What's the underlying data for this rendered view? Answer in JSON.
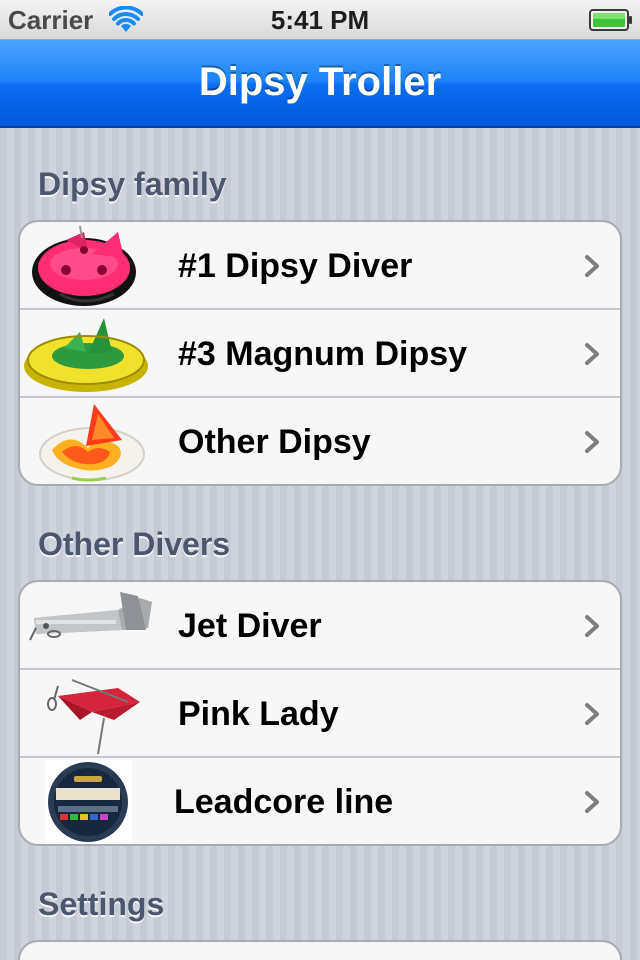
{
  "status_bar": {
    "carrier": "Carrier",
    "time": "5:41 PM",
    "wifi_icon": "wifi-icon",
    "battery_icon": "battery-full-icon"
  },
  "nav_bar": {
    "title": "Dipsy Troller"
  },
  "sections": [
    {
      "header": "Dipsy family",
      "items": [
        {
          "label": "#1 Dipsy Diver",
          "thumbnail": "pink-dipsy-diver-image"
        },
        {
          "label": "#3 Magnum Dipsy",
          "thumbnail": "yellow-magnum-dipsy-image"
        },
        {
          "label": "Other Dipsy",
          "thumbnail": "flame-dipsy-image"
        }
      ]
    },
    {
      "header": "Other Divers",
      "items": [
        {
          "label": "Jet Diver",
          "thumbnail": "jet-diver-image"
        },
        {
          "label": "Pink Lady",
          "thumbnail": "pink-lady-image"
        },
        {
          "label": "Leadcore line",
          "thumbnail": "leadcore-spool-image"
        }
      ]
    },
    {
      "header": "Settings",
      "items": []
    }
  ],
  "colors": {
    "nav_bar_blue": "#0a6ef0",
    "section_header": "#4c566c",
    "cell_background": "#f7f7f7",
    "chevron": "#7f7f7f"
  }
}
